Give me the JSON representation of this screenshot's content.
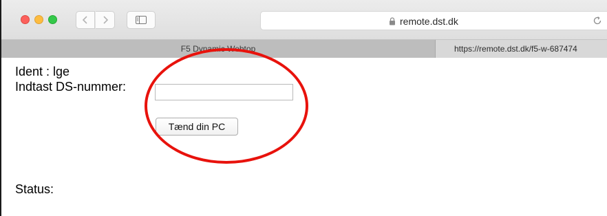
{
  "browser": {
    "url_display": "remote.dst.dk",
    "tabs": [
      {
        "label": "F5 Dynamic Webtop"
      },
      {
        "label": "https://remote.dst.dk/f5-w-687474"
      }
    ],
    "icons": {
      "back": "chevron-left-icon",
      "forward": "chevron-right-icon",
      "sidebar": "sidebar-icon",
      "lock": "lock-icon",
      "reload": "reload-icon"
    }
  },
  "page": {
    "ident_text": "Ident : lge",
    "ds_number_label": "Indtast DS-nummer:",
    "ds_number_value": "",
    "power_button_label": "Tænd din PC",
    "status_label": "Status:"
  },
  "colors": {
    "highlight_circle": "#e8120c",
    "traffic_close": "#fc605c",
    "traffic_minimize": "#fdbc40",
    "traffic_zoom": "#34c84a"
  }
}
